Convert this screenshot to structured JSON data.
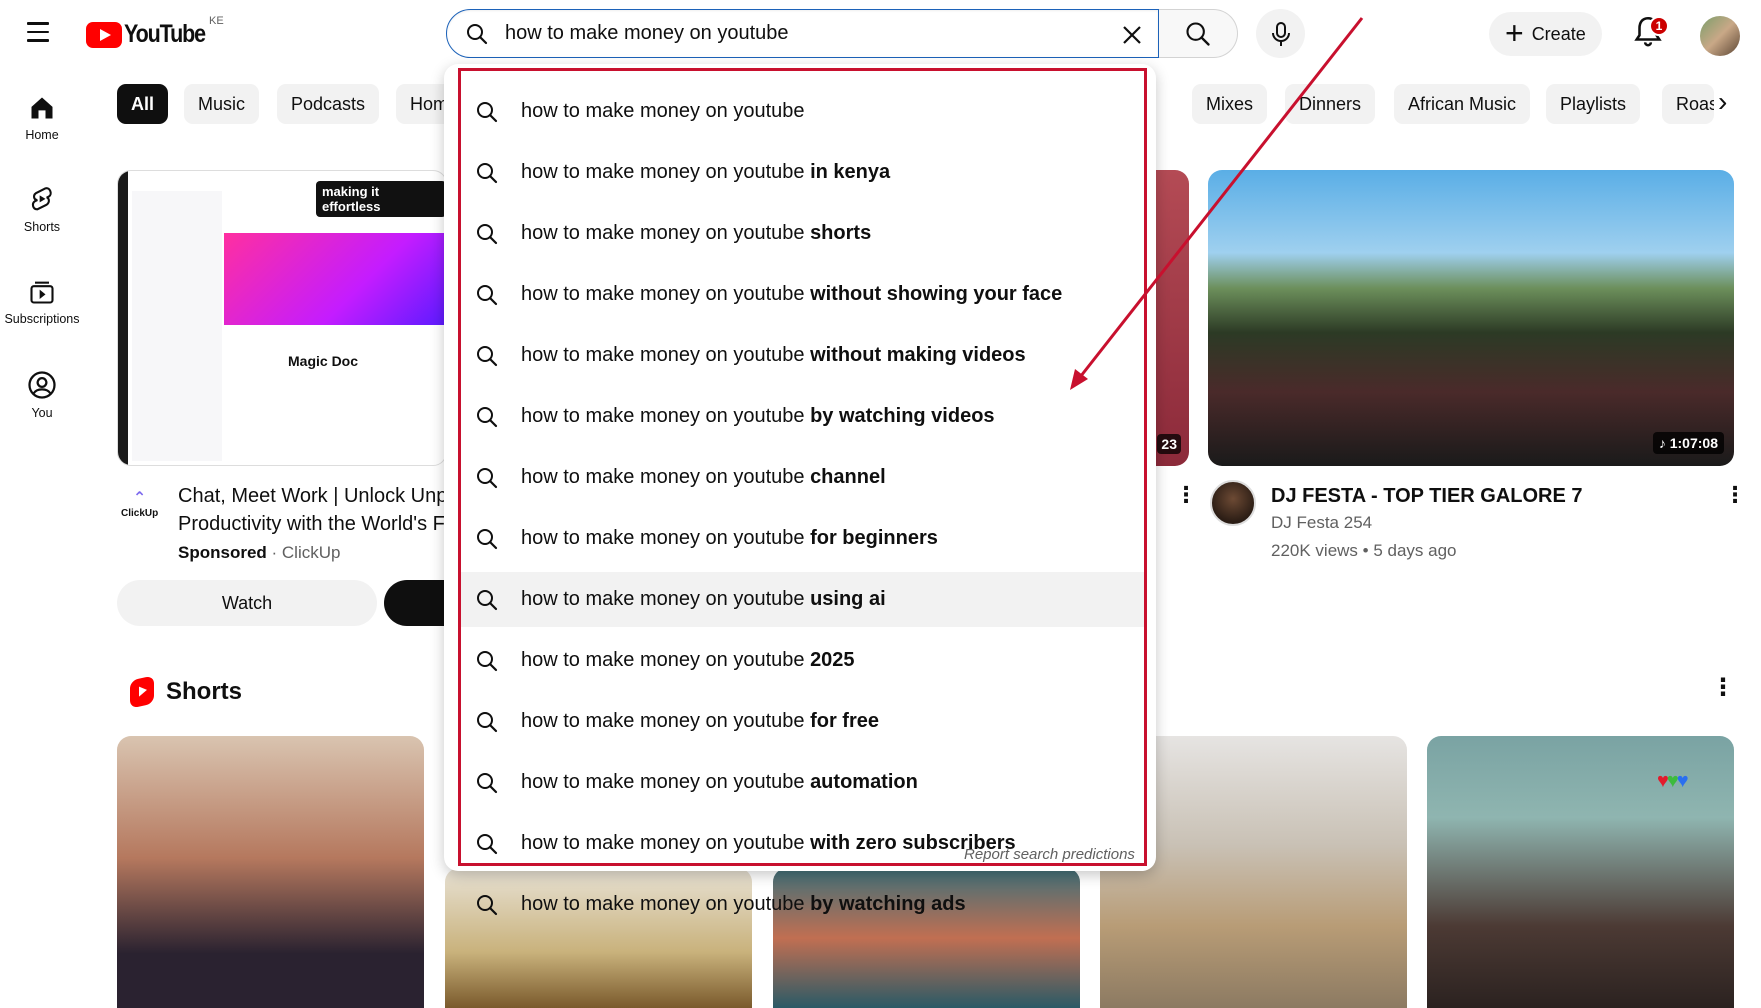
{
  "header": {
    "logo_text": "YouTube",
    "country_code": "KE",
    "search_value": "how to make money on youtube",
    "create_label": "Create",
    "notification_count": "1"
  },
  "sidebar": {
    "items": [
      {
        "label": "Home",
        "icon": "home-icon"
      },
      {
        "label": "Shorts",
        "icon": "shorts-icon"
      },
      {
        "label": "Subscriptions",
        "icon": "subscriptions-icon"
      },
      {
        "label": "You",
        "icon": "you-icon"
      }
    ]
  },
  "chips": [
    "All",
    "Music",
    "Podcasts",
    "Hom",
    "Mixes",
    "Dinners",
    "African Music",
    "Playlists",
    "Roast"
  ],
  "suggestions": [
    {
      "base": "how to make money on youtube",
      "rest": ""
    },
    {
      "base": "how to make money on youtube ",
      "rest": "in kenya"
    },
    {
      "base": "how to make money on youtube ",
      "rest": "shorts"
    },
    {
      "base": "how to make money on youtube ",
      "rest": "without showing your face"
    },
    {
      "base": "how to make money on youtube ",
      "rest": "without making videos"
    },
    {
      "base": "how to make money on youtube ",
      "rest": "by watching videos"
    },
    {
      "base": "how to make money on youtube ",
      "rest": "channel"
    },
    {
      "base": "how to make money on youtube ",
      "rest": "for beginners"
    },
    {
      "base": "how to make money on youtube ",
      "rest": "using ai"
    },
    {
      "base": "how to make money on youtube ",
      "rest": "2025"
    },
    {
      "base": "how to make money on youtube ",
      "rest": "for free"
    },
    {
      "base": "how to make money on youtube ",
      "rest": "automation"
    },
    {
      "base": "how to make money on youtube ",
      "rest": "with zero subscribers"
    },
    {
      "base": "how to make money on youtube ",
      "rest": "by watching ads"
    }
  ],
  "report_label": "Report search predictions",
  "ad": {
    "thumb_caption": "making it effortless",
    "thumb_doc": "Magic Doc",
    "logo_text": "ClickUp",
    "title_line1": "Chat, Meet Work | Unlock Unp",
    "title_line2": "Productivity with the World's F",
    "sponsored": "Sponsored",
    "advertiser": "ClickUp",
    "watch_label": "Watch"
  },
  "mid_video": {
    "duration": "23"
  },
  "video": {
    "duration": "1:07:08",
    "title": "DJ FESTA - TOP TIER GALORE 7",
    "channel": "DJ Festa 254",
    "meta": "220K views • 5 days ago"
  },
  "shorts": {
    "title": "Shorts"
  },
  "colors": {
    "brand": "#ff0000",
    "highlight_box": "#c8102e",
    "badge": "#cc0000"
  }
}
